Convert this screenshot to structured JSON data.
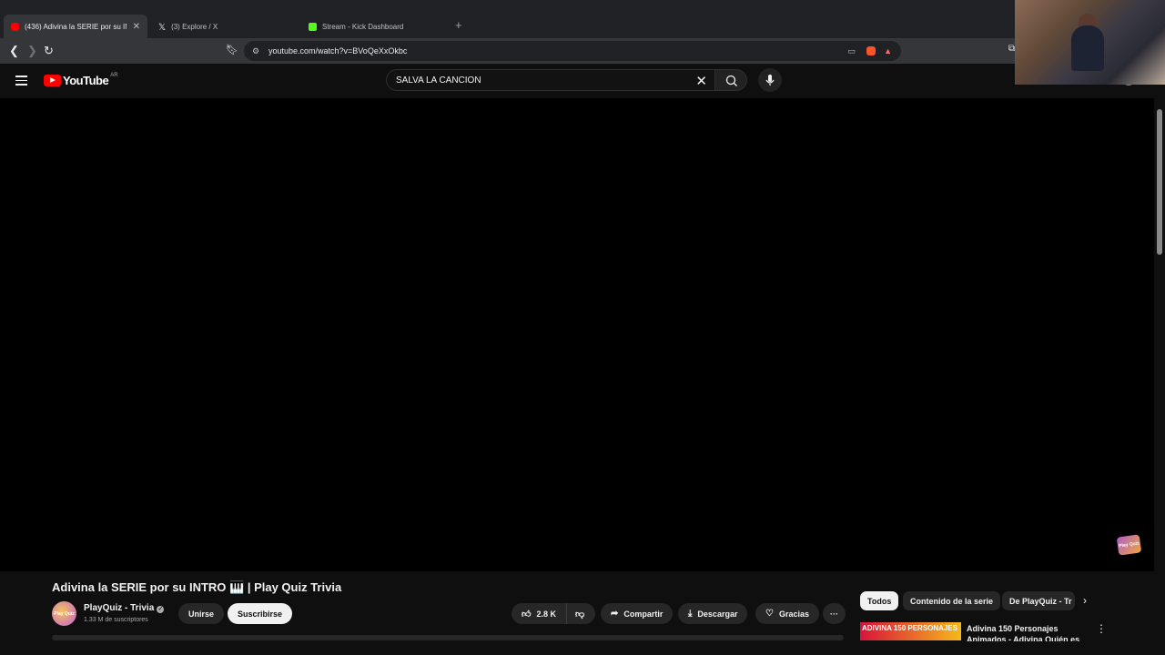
{
  "browser": {
    "tabs": [
      {
        "label": "(436) Adivina la SERIE por su INT",
        "active": true,
        "favicon": "youtube-icon"
      },
      {
        "label": "(3) Explore / X",
        "active": false,
        "favicon": "x-icon"
      },
      {
        "label": "Stream - Kick Dashboard",
        "active": false,
        "favicon": "kick-icon"
      }
    ],
    "new_tab": "+",
    "url": "youtube.com/watch?v=BVoQeXxOkbc"
  },
  "youtube": {
    "logo_text": "YouTube",
    "country_code": "AR",
    "search_value": "SALVA LA CANCION"
  },
  "video": {
    "title": "Adivina la SERIE por su INTRO 🎹 | Play Quiz Trivia",
    "watermark": "Play Quiz"
  },
  "channel": {
    "name": "PlayQuiz - Trivia",
    "subscribers": "1.33 M de suscriptores",
    "avatar_text": "Play Quiz",
    "join_label": "Unirse",
    "subscribe_label": "Suscribirse"
  },
  "actions": {
    "likes": "2.8 K",
    "share": "Compartir",
    "download": "Descargar",
    "thanks": "Gracias",
    "more": "···"
  },
  "chips": [
    "Todos",
    "Contenido de la serie",
    "De PlayQuiz - Tr"
  ],
  "recommendation": {
    "thumb_text": "ADIVINA 150 PERSONAJES",
    "title": "Adivina 150 Personajes Animados - Adivina Quién es"
  },
  "colors": {
    "accent": "#ff0000",
    "background": "#0f0f0f"
  }
}
